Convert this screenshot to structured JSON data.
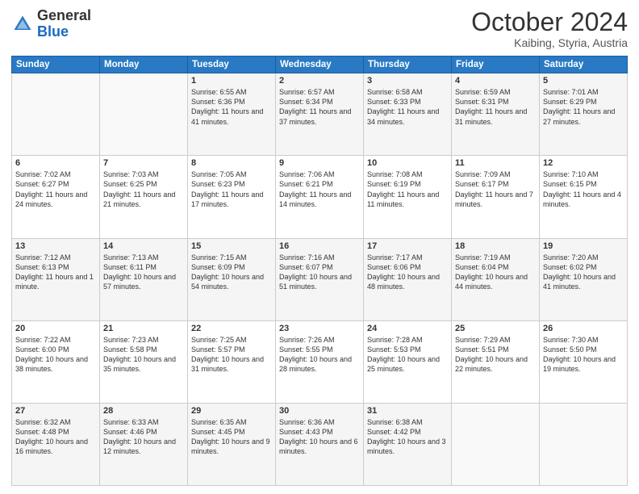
{
  "header": {
    "logo_general": "General",
    "logo_blue": "Blue",
    "title": "October 2024",
    "subtitle": "Kaibing, Styria, Austria"
  },
  "weekdays": [
    "Sunday",
    "Monday",
    "Tuesday",
    "Wednesday",
    "Thursday",
    "Friday",
    "Saturday"
  ],
  "weeks": [
    [
      {
        "day": "",
        "sunrise": "",
        "sunset": "",
        "daylight": ""
      },
      {
        "day": "",
        "sunrise": "",
        "sunset": "",
        "daylight": ""
      },
      {
        "day": "1",
        "sunrise": "Sunrise: 6:55 AM",
        "sunset": "Sunset: 6:36 PM",
        "daylight": "Daylight: 11 hours and 41 minutes."
      },
      {
        "day": "2",
        "sunrise": "Sunrise: 6:57 AM",
        "sunset": "Sunset: 6:34 PM",
        "daylight": "Daylight: 11 hours and 37 minutes."
      },
      {
        "day": "3",
        "sunrise": "Sunrise: 6:58 AM",
        "sunset": "Sunset: 6:33 PM",
        "daylight": "Daylight: 11 hours and 34 minutes."
      },
      {
        "day": "4",
        "sunrise": "Sunrise: 6:59 AM",
        "sunset": "Sunset: 6:31 PM",
        "daylight": "Daylight: 11 hours and 31 minutes."
      },
      {
        "day": "5",
        "sunrise": "Sunrise: 7:01 AM",
        "sunset": "Sunset: 6:29 PM",
        "daylight": "Daylight: 11 hours and 27 minutes."
      }
    ],
    [
      {
        "day": "6",
        "sunrise": "Sunrise: 7:02 AM",
        "sunset": "Sunset: 6:27 PM",
        "daylight": "Daylight: 11 hours and 24 minutes."
      },
      {
        "day": "7",
        "sunrise": "Sunrise: 7:03 AM",
        "sunset": "Sunset: 6:25 PM",
        "daylight": "Daylight: 11 hours and 21 minutes."
      },
      {
        "day": "8",
        "sunrise": "Sunrise: 7:05 AM",
        "sunset": "Sunset: 6:23 PM",
        "daylight": "Daylight: 11 hours and 17 minutes."
      },
      {
        "day": "9",
        "sunrise": "Sunrise: 7:06 AM",
        "sunset": "Sunset: 6:21 PM",
        "daylight": "Daylight: 11 hours and 14 minutes."
      },
      {
        "day": "10",
        "sunrise": "Sunrise: 7:08 AM",
        "sunset": "Sunset: 6:19 PM",
        "daylight": "Daylight: 11 hours and 11 minutes."
      },
      {
        "day": "11",
        "sunrise": "Sunrise: 7:09 AM",
        "sunset": "Sunset: 6:17 PM",
        "daylight": "Daylight: 11 hours and 7 minutes."
      },
      {
        "day": "12",
        "sunrise": "Sunrise: 7:10 AM",
        "sunset": "Sunset: 6:15 PM",
        "daylight": "Daylight: 11 hours and 4 minutes."
      }
    ],
    [
      {
        "day": "13",
        "sunrise": "Sunrise: 7:12 AM",
        "sunset": "Sunset: 6:13 PM",
        "daylight": "Daylight: 11 hours and 1 minute."
      },
      {
        "day": "14",
        "sunrise": "Sunrise: 7:13 AM",
        "sunset": "Sunset: 6:11 PM",
        "daylight": "Daylight: 10 hours and 57 minutes."
      },
      {
        "day": "15",
        "sunrise": "Sunrise: 7:15 AM",
        "sunset": "Sunset: 6:09 PM",
        "daylight": "Daylight: 10 hours and 54 minutes."
      },
      {
        "day": "16",
        "sunrise": "Sunrise: 7:16 AM",
        "sunset": "Sunset: 6:07 PM",
        "daylight": "Daylight: 10 hours and 51 minutes."
      },
      {
        "day": "17",
        "sunrise": "Sunrise: 7:17 AM",
        "sunset": "Sunset: 6:06 PM",
        "daylight": "Daylight: 10 hours and 48 minutes."
      },
      {
        "day": "18",
        "sunrise": "Sunrise: 7:19 AM",
        "sunset": "Sunset: 6:04 PM",
        "daylight": "Daylight: 10 hours and 44 minutes."
      },
      {
        "day": "19",
        "sunrise": "Sunrise: 7:20 AM",
        "sunset": "Sunset: 6:02 PM",
        "daylight": "Daylight: 10 hours and 41 minutes."
      }
    ],
    [
      {
        "day": "20",
        "sunrise": "Sunrise: 7:22 AM",
        "sunset": "Sunset: 6:00 PM",
        "daylight": "Daylight: 10 hours and 38 minutes."
      },
      {
        "day": "21",
        "sunrise": "Sunrise: 7:23 AM",
        "sunset": "Sunset: 5:58 PM",
        "daylight": "Daylight: 10 hours and 35 minutes."
      },
      {
        "day": "22",
        "sunrise": "Sunrise: 7:25 AM",
        "sunset": "Sunset: 5:57 PM",
        "daylight": "Daylight: 10 hours and 31 minutes."
      },
      {
        "day": "23",
        "sunrise": "Sunrise: 7:26 AM",
        "sunset": "Sunset: 5:55 PM",
        "daylight": "Daylight: 10 hours and 28 minutes."
      },
      {
        "day": "24",
        "sunrise": "Sunrise: 7:28 AM",
        "sunset": "Sunset: 5:53 PM",
        "daylight": "Daylight: 10 hours and 25 minutes."
      },
      {
        "day": "25",
        "sunrise": "Sunrise: 7:29 AM",
        "sunset": "Sunset: 5:51 PM",
        "daylight": "Daylight: 10 hours and 22 minutes."
      },
      {
        "day": "26",
        "sunrise": "Sunrise: 7:30 AM",
        "sunset": "Sunset: 5:50 PM",
        "daylight": "Daylight: 10 hours and 19 minutes."
      }
    ],
    [
      {
        "day": "27",
        "sunrise": "Sunrise: 6:32 AM",
        "sunset": "Sunset: 4:48 PM",
        "daylight": "Daylight: 10 hours and 16 minutes."
      },
      {
        "day": "28",
        "sunrise": "Sunrise: 6:33 AM",
        "sunset": "Sunset: 4:46 PM",
        "daylight": "Daylight: 10 hours and 12 minutes."
      },
      {
        "day": "29",
        "sunrise": "Sunrise: 6:35 AM",
        "sunset": "Sunset: 4:45 PM",
        "daylight": "Daylight: 10 hours and 9 minutes."
      },
      {
        "day": "30",
        "sunrise": "Sunrise: 6:36 AM",
        "sunset": "Sunset: 4:43 PM",
        "daylight": "Daylight: 10 hours and 6 minutes."
      },
      {
        "day": "31",
        "sunrise": "Sunrise: 6:38 AM",
        "sunset": "Sunset: 4:42 PM",
        "daylight": "Daylight: 10 hours and 3 minutes."
      },
      {
        "day": "",
        "sunrise": "",
        "sunset": "",
        "daylight": ""
      },
      {
        "day": "",
        "sunrise": "",
        "sunset": "",
        "daylight": ""
      }
    ]
  ]
}
